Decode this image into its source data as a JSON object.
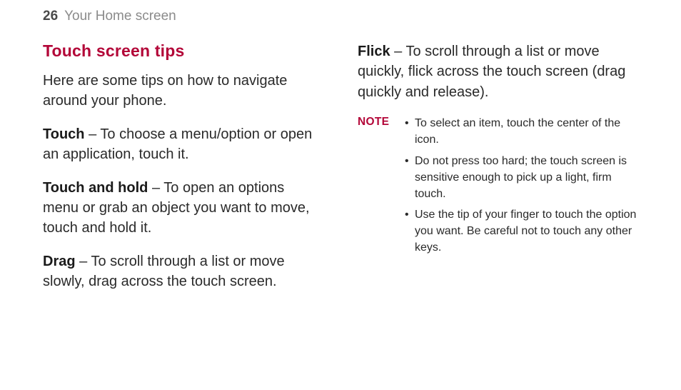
{
  "header": {
    "page_number": "26",
    "running_title": "Your Home screen"
  },
  "left": {
    "heading": "Touch screen tips",
    "intro": "Here are some tips on how to navigate around your phone.",
    "touch_term": "Touch",
    "touch_desc": " – To choose a menu/option or open an application, touch it.",
    "hold_term": "Touch and hold",
    "hold_desc": " – To open an options menu or grab an object you want to move, touch and hold it.",
    "drag_term": "Drag",
    "drag_desc": " – To scroll through a list or move slowly, drag across the touch screen."
  },
  "right": {
    "flick_term": "Flick",
    "flick_desc": " – To scroll through a list or move quickly, flick across the touch screen (drag quickly and release).",
    "note_label": "NOTE",
    "notes": [
      "To select an item, touch the center of the icon.",
      "Do not press too hard; the touch screen is sensitive enough to pick up a light, firm touch.",
      "Use the tip of your finger to touch the option you want. Be careful not to touch any other keys."
    ]
  }
}
